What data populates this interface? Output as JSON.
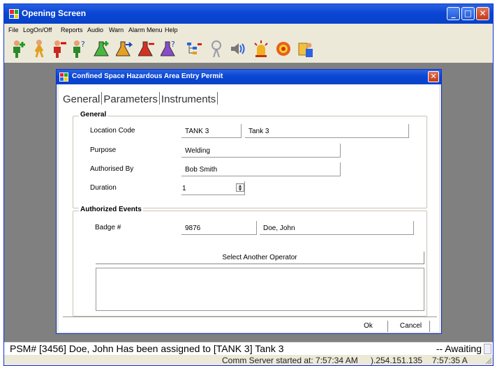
{
  "window": {
    "title": "Opening Screen",
    "controls": {
      "minimize": "_",
      "maximize": "□",
      "close": "✕"
    }
  },
  "menu": [
    "File",
    "LogOn/Off",
    "Reports",
    "Audio",
    "Warn",
    "Alarm Menu",
    "Help"
  ],
  "toolbar": {
    "icons": [
      "operator-add-icon",
      "operator-walk-icon",
      "operator-remove-icon",
      "operator-query-icon",
      "flask-add-icon",
      "flask-arrow-icon",
      "flask-remove-icon",
      "flask-query-icon",
      "tree-view-icon",
      "antenna-icon",
      "speaker-icon",
      "alarm-light-icon",
      "power-ring-icon",
      "report-person-icon"
    ]
  },
  "dialog": {
    "title": "Confined Space Hazardous  Area Entry Permit",
    "close": "✕",
    "tabs": [
      "General",
      "Parameters",
      "Instruments"
    ],
    "general": {
      "title": "General",
      "location_code_label": "Location Code",
      "location_code": "TANK 3",
      "location_name": "Tank 3",
      "purpose_label": "Purpose",
      "purpose": "Welding",
      "authorised_by_label": "Authorised By",
      "authorised_by": "Bob Smith",
      "duration_label": "Duration",
      "duration": "1"
    },
    "events": {
      "title": "Authorized Events",
      "badge_label": "Badge  #",
      "badge": "9876",
      "operator_name": "Doe, John",
      "select_button": "Select Another Operator"
    },
    "ok": "Ok",
    "cancel": "Cancel"
  },
  "status": {
    "message": "PSM# [3456] Doe, John Has been assigned to [TANK 3] Tank 3",
    "right": "-- Awaiting"
  },
  "statusbar": {
    "comm": "Comm Server started at: 7:57:34 AM",
    "ip": ").254.151.135",
    "time": "7:57:35 A"
  },
  "colors": {
    "titlebar": "#0a46d4",
    "desktop": "#808080",
    "dialog_face": "#ece9d8",
    "close_button": "#c53a1c"
  }
}
